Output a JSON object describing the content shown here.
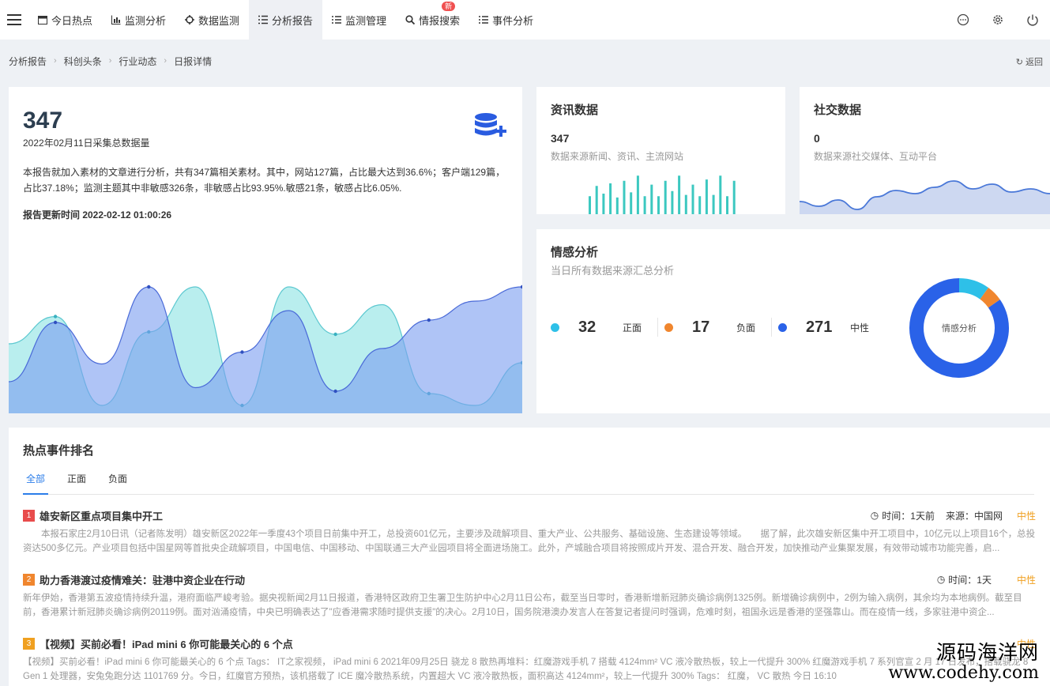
{
  "nav": {
    "items": [
      {
        "label": "今日热点",
        "icon": "calendar-icon"
      },
      {
        "label": "监测分析",
        "icon": "bar-chart-icon"
      },
      {
        "label": "数据监测",
        "icon": "crosshair-icon"
      },
      {
        "label": "分析报告",
        "icon": "list-check-icon"
      },
      {
        "label": "监测管理",
        "icon": "list-icon"
      },
      {
        "label": "情报搜索",
        "icon": "search-icon"
      },
      {
        "label": "事件分析",
        "icon": "list-icon"
      }
    ],
    "badge": "新",
    "right_icons": [
      "chat-icon",
      "gear-icon",
      "power-icon"
    ]
  },
  "breadcrumb": [
    "分析报告",
    "科创头条",
    "行业动态",
    "日报详情"
  ],
  "back_label": "返回",
  "overview": {
    "total": "347",
    "date_label": "2022年02月11日采集总数据量",
    "description": "本报告就加入素材的文章进行分析，共有347篇相关素材。其中，网站127篇，占比最大达到36.6%；客户端129篇，占比37.18%；监测主题其中非敏感326条，非敏感占比93.95%.敏感21条，敏感占比6.05%.",
    "update_time": "报告更新时间 2022-02-12 01:00:26",
    "chart_data": {
      "type": "area",
      "series": [
        {
          "values": [
            52,
            75,
            0,
            62,
            100,
            0,
            100,
            60,
            85,
            10,
            0,
            36
          ]
        },
        {
          "values": [
            20,
            70,
            35,
            100,
            15,
            45,
            80,
            12,
            48,
            72,
            88,
            100
          ]
        }
      ],
      "colors": [
        "#7fe0e0",
        "#7a9cf0"
      ]
    }
  },
  "news_data": {
    "title": "资讯数据",
    "value": "347",
    "subtitle": "数据来源新闻、资讯、主流网站",
    "chart_data": {
      "type": "bar",
      "values": [
        14,
        22,
        16,
        24,
        13,
        26,
        17,
        30,
        14,
        23,
        14,
        26,
        18,
        30,
        15,
        23,
        14,
        27,
        15,
        30,
        14,
        26
      ],
      "color": "#3cc8c0"
    }
  },
  "social_data": {
    "title": "社交数据",
    "value": "0",
    "subtitle": "数据来源社交媒体、互动平台",
    "chart_data": {
      "type": "area",
      "values": [
        12,
        6,
        14,
        2,
        18,
        26,
        22,
        30,
        38,
        28,
        34,
        24,
        28,
        22
      ],
      "color": "#4a78d8"
    }
  },
  "emotion": {
    "title": "情感分析",
    "subtitle": "当日所有数据来源汇总分析",
    "center_label": "情感分析",
    "chart_data": {
      "type": "pie",
      "categories": [
        "正面",
        "负面",
        "中性"
      ],
      "values": [
        32,
        17,
        271
      ],
      "colors": [
        "#2ec0e8",
        "#f0862e",
        "#2a62e8"
      ]
    },
    "items": [
      {
        "value": "32",
        "label": "正面",
        "color": "#2ec0e8"
      },
      {
        "value": "17",
        "label": "负面",
        "color": "#f0862e"
      },
      {
        "value": "271",
        "label": "中性",
        "color": "#2a62e8"
      }
    ]
  },
  "hot": {
    "title": "热点事件排名",
    "tabs": [
      "全部",
      "正面",
      "负面"
    ],
    "events": [
      {
        "rank": "1",
        "rank_color": "#e84c4c",
        "title": "雄安新区重点项目集中开工",
        "time_label": "时间：1天前",
        "source_label": "来源：中国网",
        "sentiment": "中性",
        "body": "　　本报石家庄2月10日讯（记者陈发明）雄安新区2022年一季度43个项目日前集中开工，总投资601亿元，主要涉及疏解项目、重大产业、公共服务、基础设施、生态建设等领域。　　据了解，此次雄安新区集中开工项目中，10亿元以上项目16个，总投资达500多亿元。产业项目包括中国星网等首批央企疏解项目，中国电信、中国移动、中国联通三大产业园项目将全面进场施工。此外，产城融合项目将按照成片开发、混合开发、融合开发，加快推动产业集聚发展，有效带动城市功能完善，启..."
      },
      {
        "rank": "2",
        "rank_color": "#f0862e",
        "title": "助力香港渡过疫情难关：驻港中资企业在行动",
        "time_label": "时间：1天",
        "source_label": "",
        "sentiment": "中性",
        "body": "新年伊始，香港第五波疫情持续升温，港府面临严峻考验。据央视新闻2月11日报道，香港特区政府卫生署卫生防护中心2月11日公布，截至当日零时，香港新增新冠肺炎确诊病例1325例。新增确诊病例中，2例为输入病例，其余均为本地病例。截至目前，香港累计新冠肺炎确诊病例20119例。面对汹涌疫情，中央已明确表达了\"应香港需求随时提供支援\"的决心。2月10日，国务院港澳办发言人在答复记者提问时强调，危难时刻，祖国永远是香港的坚强靠山。而在疫情一线，多家驻港中资企..."
      },
      {
        "rank": "3",
        "rank_color": "#f0a020",
        "title": "【视频】买前必看！iPad mini 6 你可能最关心的 6 个点",
        "time_label": "",
        "source_label": "",
        "sentiment": "中性",
        "body": "【视频】买前必看！iPad mini 6 你可能最关心的 6 个点 Tags： IT之家视频， iPad mini 6 2021年09月25日 骁龙 8 散热再堆料：红魔游戏手机 7 搭载 4124mm² VC 液冷散热板，较上一代提升 300% 红魔游戏手机 7 系列官宣 2 月 17 日发布，搭载骁龙 8 Gen 1 处理器，安兔兔跑分达 1101769 分。今日，红魔官方预热，该机搭载了 ICE 魔冷散热系统，内置超大 VC 液冷散热板，面积高达 4124mm²，较上一代提升 300% Tags： 红魔， VC 散热 今日 16:10 "
      }
    ]
  },
  "watermark": {
    "line1": "源码海洋网",
    "line2": "www.codehy.com"
  }
}
